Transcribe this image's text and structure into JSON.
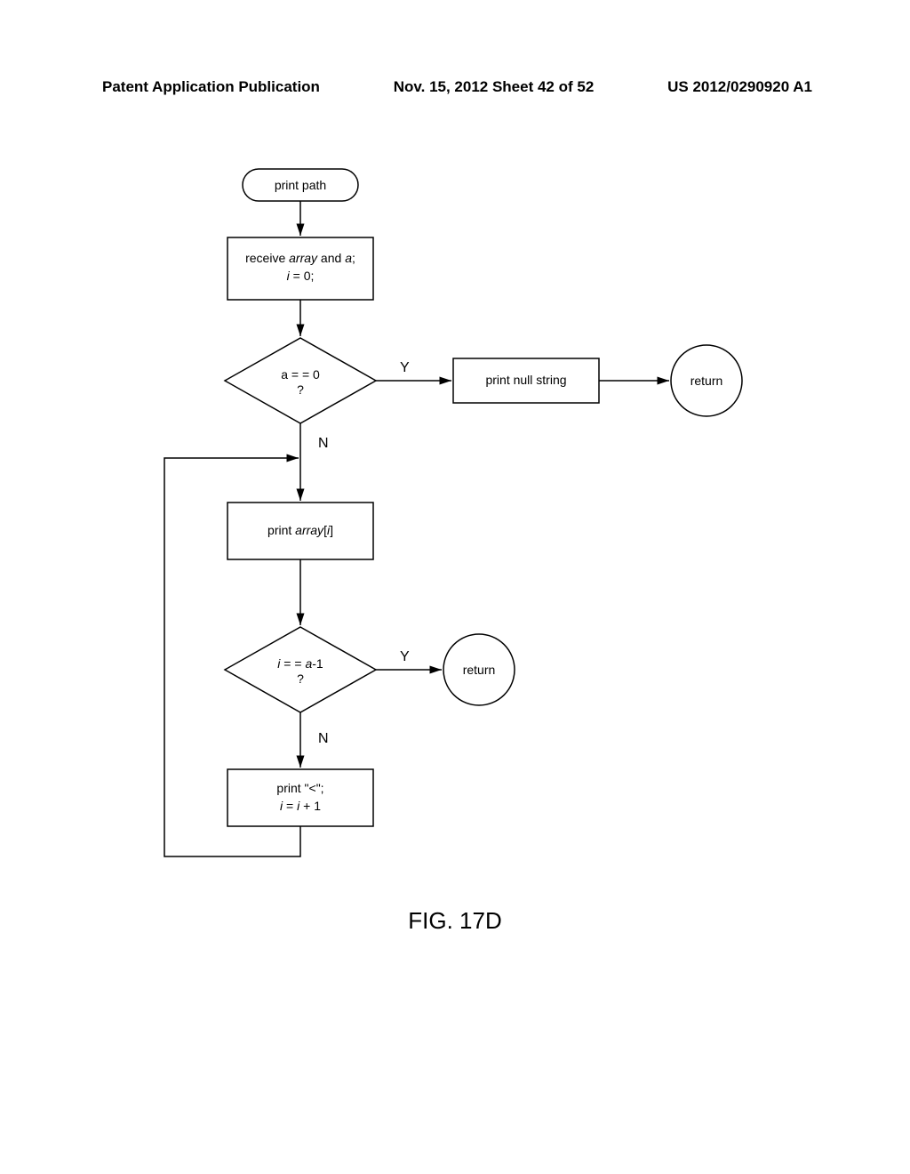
{
  "header": {
    "left": "Patent Application Publication",
    "center": "Nov. 15, 2012  Sheet 42 of 52",
    "right": "US 2012/0290920 A1"
  },
  "figure_label": "FIG. 17D",
  "chart_data": {
    "type": "flowchart",
    "nodes": [
      {
        "id": "start",
        "shape": "terminator",
        "label": "print path"
      },
      {
        "id": "recv",
        "shape": "process",
        "lines": [
          "receive array and a;",
          "i = 0;"
        ],
        "italic_hint": [
          "array",
          "a",
          "i"
        ]
      },
      {
        "id": "dec1",
        "shape": "decision",
        "lines": [
          "a = = 0",
          "?"
        ]
      },
      {
        "id": "null",
        "shape": "process",
        "lines": [
          "print null string"
        ]
      },
      {
        "id": "ret1",
        "shape": "terminator-circle",
        "label": "return"
      },
      {
        "id": "print_ai",
        "shape": "process",
        "lines": [
          "print array[i]"
        ],
        "italic_hint": [
          "array",
          "i"
        ]
      },
      {
        "id": "dec2",
        "shape": "decision",
        "lines": [
          "i = = a-1",
          "?"
        ],
        "italic_hint": [
          "i",
          "a"
        ]
      },
      {
        "id": "ret2",
        "shape": "terminator-circle",
        "label": "return"
      },
      {
        "id": "inc",
        "shape": "process",
        "lines": [
          "print \"<\";",
          "i = i + 1"
        ],
        "italic_hint": [
          "i"
        ]
      }
    ],
    "edges": [
      {
        "from": "start",
        "to": "recv"
      },
      {
        "from": "recv",
        "to": "dec1"
      },
      {
        "from": "dec1",
        "to": "null",
        "label": "Y"
      },
      {
        "from": "null",
        "to": "ret1"
      },
      {
        "from": "dec1",
        "to": "print_ai",
        "label": "N",
        "via_junction": true
      },
      {
        "from": "print_ai",
        "to": "dec2"
      },
      {
        "from": "dec2",
        "to": "ret2",
        "label": "Y"
      },
      {
        "from": "dec2",
        "to": "inc",
        "label": "N"
      },
      {
        "from": "inc",
        "to": "print_ai",
        "loop_back": true
      }
    ]
  },
  "labels": {
    "Y": "Y",
    "N": "N"
  },
  "nodes": {
    "start": "print path",
    "recv_l1a": "receive ",
    "recv_l1b": "array",
    "recv_l1c": " and ",
    "recv_l1d": "a",
    "recv_l1e": ";",
    "recv_l2a": "i",
    "recv_l2b": " = 0;",
    "dec1_l1": "a = = 0",
    "dec1_l2": "?",
    "null": "print null string",
    "ret": "return",
    "pai_a": "print ",
    "pai_b": "array",
    "pai_c": "[",
    "pai_d": "i",
    "pai_e": "]",
    "dec2_l1a": "i",
    "dec2_l1b": " = = ",
    "dec2_l1c": "a",
    "dec2_l1d": "-1",
    "dec2_l2": "?",
    "inc_l1": "print \"<\";",
    "inc_l2a": "i",
    "inc_l2b": " = ",
    "inc_l2c": "i",
    "inc_l2d": " + 1"
  }
}
